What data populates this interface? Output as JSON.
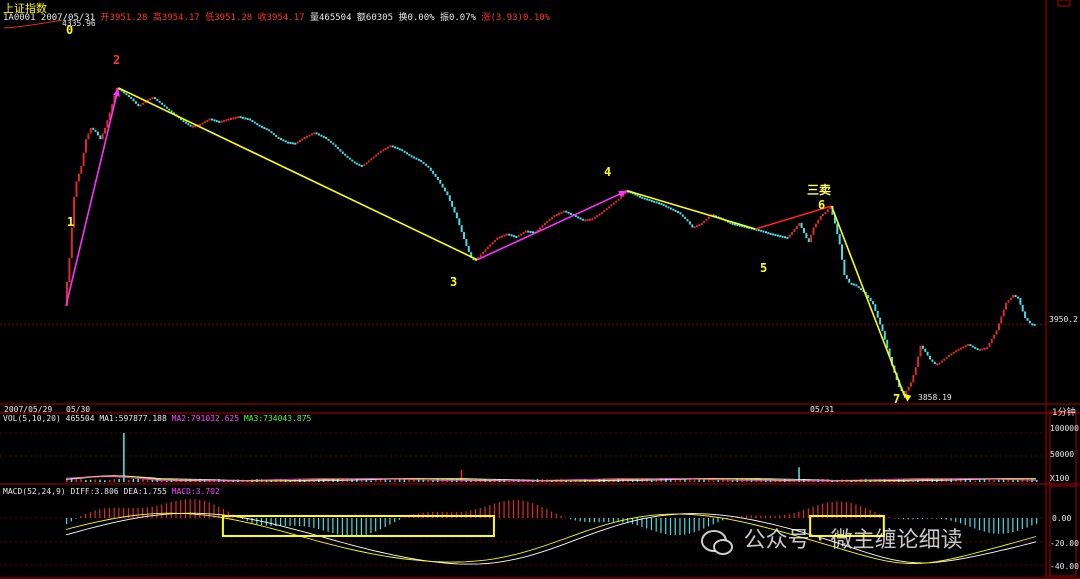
{
  "header": {
    "index_name": "上证指数",
    "code_date": "1A0001 2007/05/31",
    "open": "开3951.28",
    "high": "高3954.17",
    "low": "低3951.28",
    "close": "收3954.17",
    "volume": "量465504",
    "amount": "额60305",
    "turnover": "换0.00%",
    "amplitude": "振0.07%",
    "change": "涨(3.93)0.10%",
    "prev_ref": "4335.96"
  },
  "date_axis": {
    "left": "2007/05/29",
    "mid1": "05/30",
    "mid2": "05/31",
    "period": "1分钟"
  },
  "price_axis": {
    "current": "3950.2",
    "low_mark": "3858.19"
  },
  "vol": {
    "title": "VOL(5,10,20)",
    "value": "465504",
    "ma1": "MA1:597877.188",
    "ma2": "MA2:791032.625",
    "ma3": "MA3:734043.875",
    "ticks": [
      "100000",
      "50000",
      "X100"
    ]
  },
  "macd": {
    "title": "MACD(52,24,9)",
    "diff": "DIFF:3.806",
    "dea": "DEA:1.755",
    "macd": "MACD:3.702",
    "ticks": [
      "0.00",
      "-20.00",
      "-40.00"
    ]
  },
  "watermark": "公众号 · 微主缠论细读",
  "colors": {
    "up": "#e02a2a",
    "down": "#40e0e8",
    "yellow": "#ffff00",
    "magenta": "#ff30ff",
    "grid": "#8b0000"
  },
  "chart_data": {
    "type": "line",
    "title": "上证指数",
    "xlabel": "",
    "ylabel": "",
    "x_labels": [
      "2007/05/29",
      "05/30",
      "05/31"
    ],
    "ylim": [
      3850,
      4340
    ],
    "price_path": [
      [
        0,
        3978
      ],
      [
        2,
        4040
      ],
      [
        4,
        4120
      ],
      [
        5,
        4140
      ],
      [
        7,
        4160
      ],
      [
        9,
        4195
      ],
      [
        11,
        4210
      ],
      [
        13,
        4205
      ],
      [
        15,
        4195
      ],
      [
        17,
        4210
      ],
      [
        19,
        4230
      ],
      [
        22,
        4262
      ],
      [
        25,
        4255
      ],
      [
        28,
        4248
      ],
      [
        31,
        4238
      ],
      [
        34,
        4245
      ],
      [
        37,
        4250
      ],
      [
        41,
        4240
      ],
      [
        45,
        4230
      ],
      [
        49,
        4220
      ],
      [
        53,
        4212
      ],
      [
        57,
        4215
      ],
      [
        61,
        4222
      ],
      [
        65,
        4218
      ],
      [
        69,
        4222
      ],
      [
        73,
        4225
      ],
      [
        77,
        4222
      ],
      [
        81,
        4214
      ],
      [
        85,
        4208
      ],
      [
        89,
        4198
      ],
      [
        93,
        4192
      ],
      [
        97,
        4190
      ],
      [
        101,
        4198
      ],
      [
        105,
        4204
      ],
      [
        109,
        4198
      ],
      [
        113,
        4188
      ],
      [
        117,
        4176
      ],
      [
        121,
        4166
      ],
      [
        125,
        4160
      ],
      [
        129,
        4170
      ],
      [
        133,
        4180
      ],
      [
        137,
        4187
      ],
      [
        141,
        4182
      ],
      [
        145,
        4174
      ],
      [
        149,
        4168
      ],
      [
        153,
        4158
      ],
      [
        157,
        4142
      ],
      [
        161,
        4122
      ],
      [
        165,
        4092
      ],
      [
        169,
        4056
      ],
      [
        171,
        4040
      ],
      [
        173,
        4038
      ],
      [
        175,
        4045
      ],
      [
        178,
        4055
      ],
      [
        182,
        4067
      ],
      [
        186,
        4072
      ],
      [
        190,
        4068
      ],
      [
        194,
        4076
      ],
      [
        198,
        4074
      ],
      [
        202,
        4086
      ],
      [
        206,
        4096
      ],
      [
        210,
        4102
      ],
      [
        214,
        4096
      ],
      [
        218,
        4090
      ],
      [
        222,
        4092
      ],
      [
        226,
        4100
      ],
      [
        230,
        4110
      ],
      [
        234,
        4120
      ],
      [
        236,
        4128
      ],
      [
        238,
        4126
      ],
      [
        242,
        4120
      ],
      [
        246,
        4116
      ],
      [
        250,
        4112
      ],
      [
        254,
        4106
      ],
      [
        258,
        4100
      ],
      [
        262,
        4088
      ],
      [
        264,
        4080
      ],
      [
        268,
        4086
      ],
      [
        272,
        4097
      ],
      [
        276,
        4092
      ],
      [
        280,
        4086
      ],
      [
        284,
        4083
      ],
      [
        288,
        4080
      ],
      [
        292,
        4077
      ],
      [
        296,
        4073
      ],
      [
        300,
        4070
      ],
      [
        304,
        4067
      ],
      [
        306,
        4074
      ],
      [
        309,
        4086
      ],
      [
        312,
        4066
      ],
      [
        313,
        4061
      ],
      [
        315,
        4080
      ],
      [
        318,
        4095
      ],
      [
        320,
        4100
      ],
      [
        322,
        4108
      ],
      [
        324,
        4085
      ],
      [
        326,
        4058
      ],
      [
        328,
        4018
      ],
      [
        330,
        4008
      ],
      [
        332,
        4006
      ],
      [
        336,
        3996
      ],
      [
        340,
        3980
      ],
      [
        344,
        3945
      ],
      [
        348,
        3900
      ],
      [
        351,
        3872
      ],
      [
        353,
        3862
      ],
      [
        356,
        3878
      ],
      [
        358,
        3898
      ],
      [
        360,
        3926
      ],
      [
        362,
        3918
      ],
      [
        364,
        3908
      ],
      [
        366,
        3902
      ],
      [
        368,
        3904
      ],
      [
        372,
        3914
      ],
      [
        376,
        3922
      ],
      [
        380,
        3928
      ],
      [
        384,
        3921
      ],
      [
        388,
        3924
      ],
      [
        392,
        3946
      ],
      [
        396,
        3982
      ],
      [
        399,
        3992
      ],
      [
        401,
        3988
      ],
      [
        404,
        3962
      ],
      [
        406,
        3955
      ],
      [
        408,
        3954
      ]
    ],
    "pivots": [
      {
        "label": "0",
        "i": 0,
        "y": 4335.96
      },
      {
        "label": "1",
        "i": 0,
        "y": 3978
      },
      {
        "label": "2",
        "i": 22,
        "y": 4262
      },
      {
        "label": "3",
        "i": 173,
        "y": 4038
      },
      {
        "label": "4",
        "i": 236,
        "y": 4128
      },
      {
        "label": "5",
        "i": 290,
        "y": 4078
      },
      {
        "label": "6",
        "i": 322,
        "y": 4108
      },
      {
        "label": "7",
        "i": 353,
        "y": 3858.19
      }
    ],
    "segment_colors": [
      "magenta",
      "yellow",
      "magenta",
      "yellow",
      "red",
      "yellow"
    ],
    "annotation_sell": "三卖",
    "vol_spikes": [
      {
        "i": 24,
        "v": 100000
      },
      {
        "i": 166,
        "v": 25000
      },
      {
        "i": 308,
        "v": 30000
      }
    ],
    "macd_boxes": [
      {
        "i0": 66,
        "i1": 180
      },
      {
        "i0": 313,
        "i1": 344
      }
    ]
  }
}
